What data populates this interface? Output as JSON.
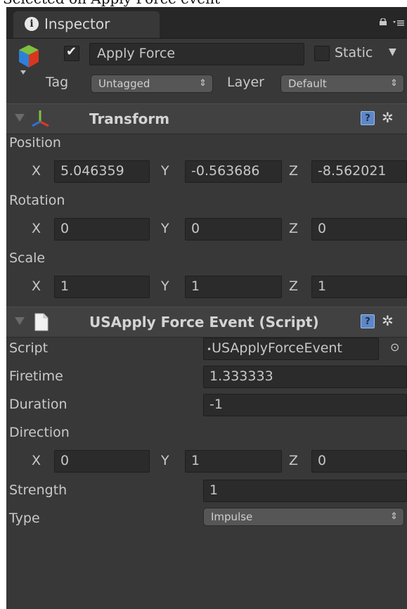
{
  "caption_text": "Selected on Apply Force event",
  "inspector": {
    "tab_label": "Inspector",
    "object": {
      "active_check": "✔",
      "name": "Apply Force",
      "static_label": "Static",
      "tag_label": "Tag",
      "tag_value": "Untagged",
      "layer_label": "Layer",
      "layer_value": "Default"
    },
    "transform": {
      "title": "Transform",
      "position_label": "Position",
      "position": {
        "x_label": "X",
        "x": "5.046359",
        "y_label": "Y",
        "y": "-0.563686",
        "z_label": "Z",
        "z": "-8.562021"
      },
      "rotation_label": "Rotation",
      "rotation": {
        "x_label": "X",
        "x": "0",
        "y_label": "Y",
        "y": "0",
        "z_label": "Z",
        "z": "0"
      },
      "scale_label": "Scale",
      "scale": {
        "x_label": "X",
        "x": "1",
        "y_label": "Y",
        "y": "1",
        "z_label": "Z",
        "z": "1"
      }
    },
    "script_component": {
      "title": "USApply Force Event (Script)",
      "script_label": "Script",
      "script_value": "USApplyForceEvent",
      "firetime_label": "Firetime",
      "firetime_value": "1.333333",
      "duration_label": "Duration",
      "duration_value": "-1",
      "direction_label": "Direction",
      "direction": {
        "x_label": "X",
        "x": "0",
        "y_label": "Y",
        "y": "1",
        "z_label": "Z",
        "z": "0"
      },
      "strength_label": "Strength",
      "strength_value": "1",
      "type_label": "Type",
      "type_value": "Impulse"
    },
    "icons": {
      "help": "?",
      "gear": "✲",
      "popup_arrow": "⇕",
      "dropdown_arrow": "▼",
      "object_picker": "⊙"
    },
    "colors": {
      "panel_bg": "#383838",
      "field_bg": "#2b2b2b",
      "text": "#c9c9c9",
      "help_icon": "#5d87c8"
    }
  }
}
